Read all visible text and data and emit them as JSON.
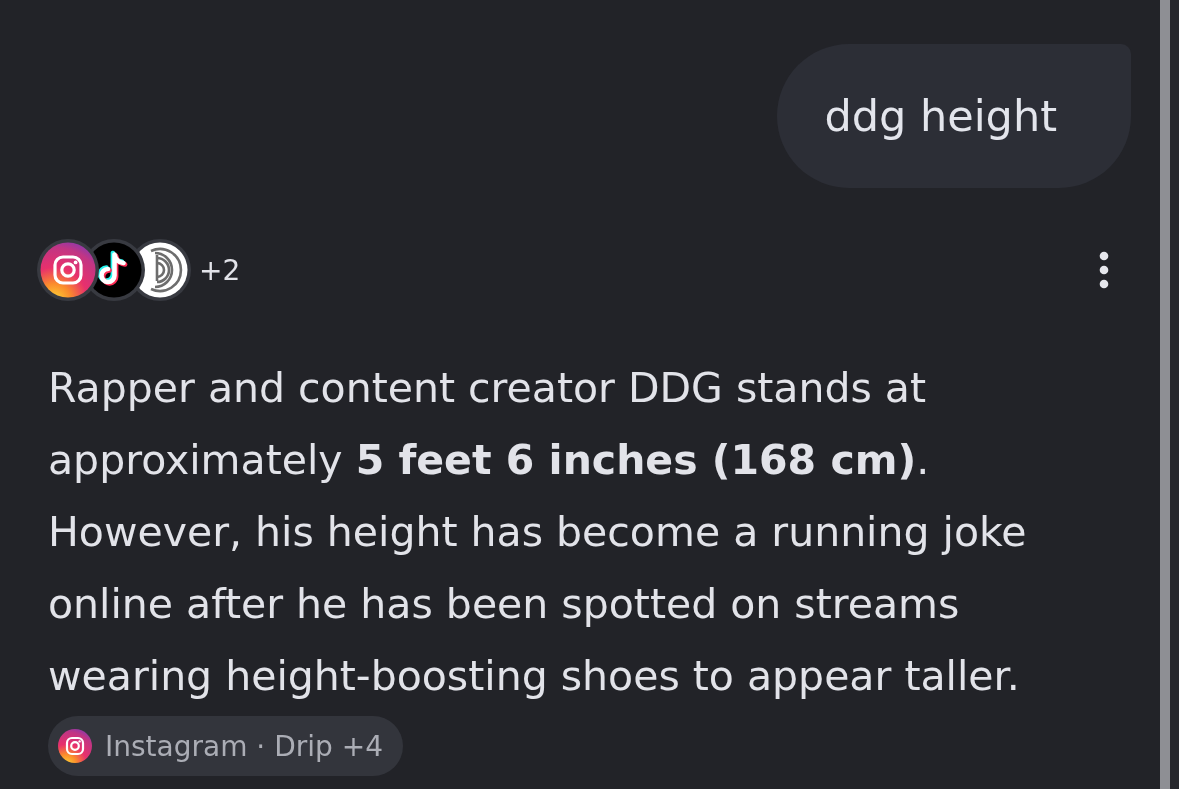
{
  "query": {
    "text": "ddg height"
  },
  "answer": {
    "source_count": "+2",
    "text": "Rapper and content creator DDG stands at approximately **5 feet 6 inches (168 cm)**. However, his height has become a running joke online after he has been spotted on streams wearing height-boosting shoes to appear taller.",
    "source_chip": {
      "label": "Instagram · Drip +4"
    }
  }
}
